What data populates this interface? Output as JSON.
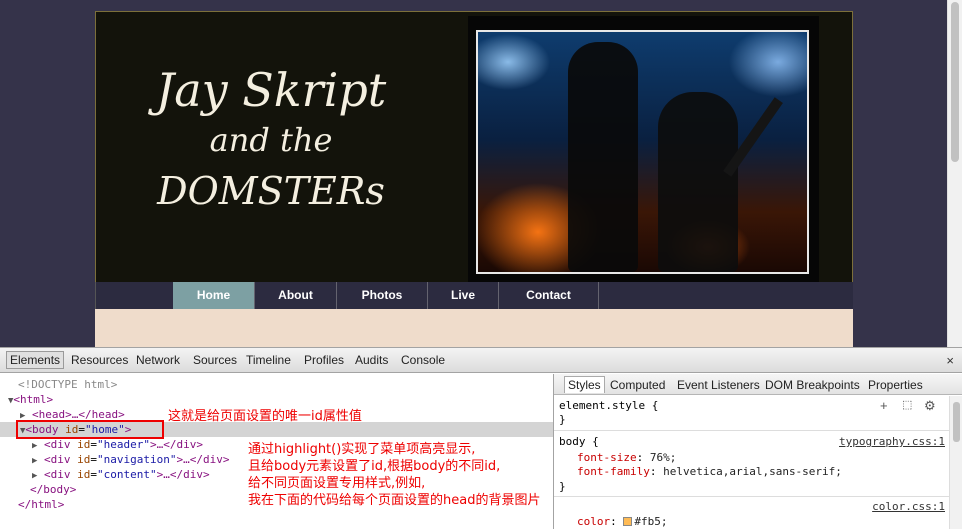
{
  "site": {
    "logo_line1": "Jay Skript",
    "logo_line2": "and the",
    "logo_line3": "DOMSTERs",
    "nav": [
      {
        "label": "Home",
        "active": true
      },
      {
        "label": "About",
        "active": false
      },
      {
        "label": "Photos",
        "active": false
      },
      {
        "label": "Live",
        "active": false
      },
      {
        "label": "Contact",
        "active": false
      }
    ]
  },
  "devtools": {
    "tabs": [
      "Elements",
      "Resources",
      "Network",
      "Sources",
      "Timeline",
      "Profiles",
      "Audits",
      "Console"
    ],
    "active_tab": "Elements",
    "close_label": "×",
    "tree": {
      "doctype": "<!DOCTYPE html>",
      "html_open": "<html>",
      "head": "<head>…</head>",
      "body_tag": "body",
      "body_attr": "id",
      "body_val": "\"home\"",
      "div_header_attr": "id",
      "div_header_val": "\"header\"",
      "div_nav_val": "\"navigation\"",
      "div_content_val": "\"content\"",
      "ellipsis_close": ">…</div>",
      "body_close": "</body>",
      "html_close": "</html>"
    },
    "annotations": {
      "body_id": "这就是给页面设置的唯一id属性值",
      "line1": "通过highlight()实现了菜单项高亮显示,",
      "line2": "且给body元素设置了id,根据body的不同id,",
      "line3": "给不同页面设置专用样式,例如,",
      "line4": "我在下面的代码给每个页面设置的head的背景图片"
    },
    "styles": {
      "tabs": [
        "Styles",
        "Computed",
        "Event Listeners",
        "DOM Breakpoints",
        "Properties"
      ],
      "element_style": "element.style {",
      "close_brace": "}",
      "rule1_selector": "body {",
      "rule1_source": "typography.css:1",
      "rule1_props": [
        {
          "name": "font-size",
          "value": "76%;"
        },
        {
          "name": "font-family",
          "value": "helvetica,arial,sans-serif;"
        }
      ],
      "rule2_source": "color.css:1",
      "rule2_prop": "color",
      "rule2_value": "#fb5;",
      "rule2_color": "#ffbb55"
    }
  }
}
